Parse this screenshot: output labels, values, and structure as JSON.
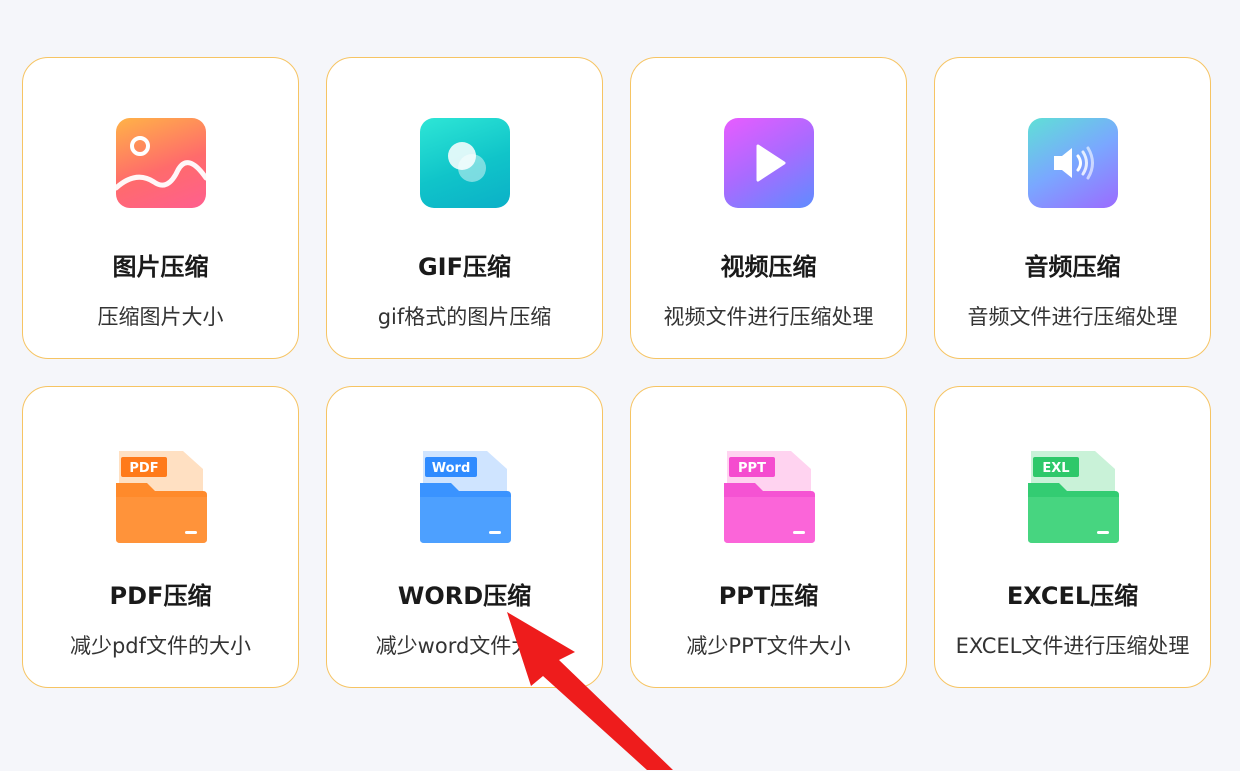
{
  "colors": {
    "card_border": "#f6c463",
    "background": "#f5f6fa",
    "arrow": "#ee1c1c"
  },
  "cards": [
    {
      "title": "图片压缩",
      "desc": "压缩图片大小",
      "icon": "image-icon"
    },
    {
      "title": "GIF压缩",
      "desc": "gif格式的图片压缩",
      "icon": "gif-icon"
    },
    {
      "title": "视频压缩",
      "desc": "视频文件进行压缩处理",
      "icon": "video-play-icon"
    },
    {
      "title": "音频压缩",
      "desc": "音频文件进行压缩处理",
      "icon": "speaker-icon"
    },
    {
      "title": "PDF压缩",
      "desc": "减少pdf文件的大小",
      "icon": "pdf-folder-icon",
      "badge": "PDF"
    },
    {
      "title": "WORD压缩",
      "desc": "减少word文件大小",
      "icon": "word-folder-icon",
      "badge": "Word"
    },
    {
      "title": "PPT压缩",
      "desc": "减少PPT文件大小",
      "icon": "ppt-folder-icon",
      "badge": "PPT"
    },
    {
      "title": "EXCEL压缩",
      "desc": "EXCEL文件进行压缩处理",
      "icon": "excel-folder-icon",
      "badge": "EXL"
    }
  ]
}
